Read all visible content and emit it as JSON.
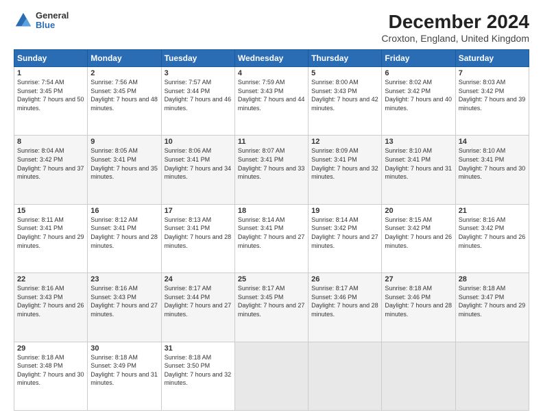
{
  "logo": {
    "general": "General",
    "blue": "Blue"
  },
  "title": "December 2024",
  "subtitle": "Croxton, England, United Kingdom",
  "headers": [
    "Sunday",
    "Monday",
    "Tuesday",
    "Wednesday",
    "Thursday",
    "Friday",
    "Saturday"
  ],
  "weeks": [
    [
      {
        "day": "1",
        "sunrise": "7:54 AM",
        "sunset": "3:45 PM",
        "daylight": "7 hours and 50 minutes."
      },
      {
        "day": "2",
        "sunrise": "7:56 AM",
        "sunset": "3:45 PM",
        "daylight": "7 hours and 48 minutes."
      },
      {
        "day": "3",
        "sunrise": "7:57 AM",
        "sunset": "3:44 PM",
        "daylight": "7 hours and 46 minutes."
      },
      {
        "day": "4",
        "sunrise": "7:59 AM",
        "sunset": "3:43 PM",
        "daylight": "7 hours and 44 minutes."
      },
      {
        "day": "5",
        "sunrise": "8:00 AM",
        "sunset": "3:43 PM",
        "daylight": "7 hours and 42 minutes."
      },
      {
        "day": "6",
        "sunrise": "8:02 AM",
        "sunset": "3:42 PM",
        "daylight": "7 hours and 40 minutes."
      },
      {
        "day": "7",
        "sunrise": "8:03 AM",
        "sunset": "3:42 PM",
        "daylight": "7 hours and 39 minutes."
      }
    ],
    [
      {
        "day": "8",
        "sunrise": "8:04 AM",
        "sunset": "3:42 PM",
        "daylight": "7 hours and 37 minutes."
      },
      {
        "day": "9",
        "sunrise": "8:05 AM",
        "sunset": "3:41 PM",
        "daylight": "7 hours and 35 minutes."
      },
      {
        "day": "10",
        "sunrise": "8:06 AM",
        "sunset": "3:41 PM",
        "daylight": "7 hours and 34 minutes."
      },
      {
        "day": "11",
        "sunrise": "8:07 AM",
        "sunset": "3:41 PM",
        "daylight": "7 hours and 33 minutes."
      },
      {
        "day": "12",
        "sunrise": "8:09 AM",
        "sunset": "3:41 PM",
        "daylight": "7 hours and 32 minutes."
      },
      {
        "day": "13",
        "sunrise": "8:10 AM",
        "sunset": "3:41 PM",
        "daylight": "7 hours and 31 minutes."
      },
      {
        "day": "14",
        "sunrise": "8:10 AM",
        "sunset": "3:41 PM",
        "daylight": "7 hours and 30 minutes."
      }
    ],
    [
      {
        "day": "15",
        "sunrise": "8:11 AM",
        "sunset": "3:41 PM",
        "daylight": "7 hours and 29 minutes."
      },
      {
        "day": "16",
        "sunrise": "8:12 AM",
        "sunset": "3:41 PM",
        "daylight": "7 hours and 28 minutes."
      },
      {
        "day": "17",
        "sunrise": "8:13 AM",
        "sunset": "3:41 PM",
        "daylight": "7 hours and 28 minutes."
      },
      {
        "day": "18",
        "sunrise": "8:14 AM",
        "sunset": "3:41 PM",
        "daylight": "7 hours and 27 minutes."
      },
      {
        "day": "19",
        "sunrise": "8:14 AM",
        "sunset": "3:42 PM",
        "daylight": "7 hours and 27 minutes."
      },
      {
        "day": "20",
        "sunrise": "8:15 AM",
        "sunset": "3:42 PM",
        "daylight": "7 hours and 26 minutes."
      },
      {
        "day": "21",
        "sunrise": "8:16 AM",
        "sunset": "3:42 PM",
        "daylight": "7 hours and 26 minutes."
      }
    ],
    [
      {
        "day": "22",
        "sunrise": "8:16 AM",
        "sunset": "3:43 PM",
        "daylight": "7 hours and 26 minutes."
      },
      {
        "day": "23",
        "sunrise": "8:16 AM",
        "sunset": "3:43 PM",
        "daylight": "7 hours and 27 minutes."
      },
      {
        "day": "24",
        "sunrise": "8:17 AM",
        "sunset": "3:44 PM",
        "daylight": "7 hours and 27 minutes."
      },
      {
        "day": "25",
        "sunrise": "8:17 AM",
        "sunset": "3:45 PM",
        "daylight": "7 hours and 27 minutes."
      },
      {
        "day": "26",
        "sunrise": "8:17 AM",
        "sunset": "3:46 PM",
        "daylight": "7 hours and 28 minutes."
      },
      {
        "day": "27",
        "sunrise": "8:18 AM",
        "sunset": "3:46 PM",
        "daylight": "7 hours and 28 minutes."
      },
      {
        "day": "28",
        "sunrise": "8:18 AM",
        "sunset": "3:47 PM",
        "daylight": "7 hours and 29 minutes."
      }
    ],
    [
      {
        "day": "29",
        "sunrise": "8:18 AM",
        "sunset": "3:48 PM",
        "daylight": "7 hours and 30 minutes."
      },
      {
        "day": "30",
        "sunrise": "8:18 AM",
        "sunset": "3:49 PM",
        "daylight": "7 hours and 31 minutes."
      },
      {
        "day": "31",
        "sunrise": "8:18 AM",
        "sunset": "3:50 PM",
        "daylight": "7 hours and 32 minutes."
      },
      null,
      null,
      null,
      null
    ]
  ]
}
